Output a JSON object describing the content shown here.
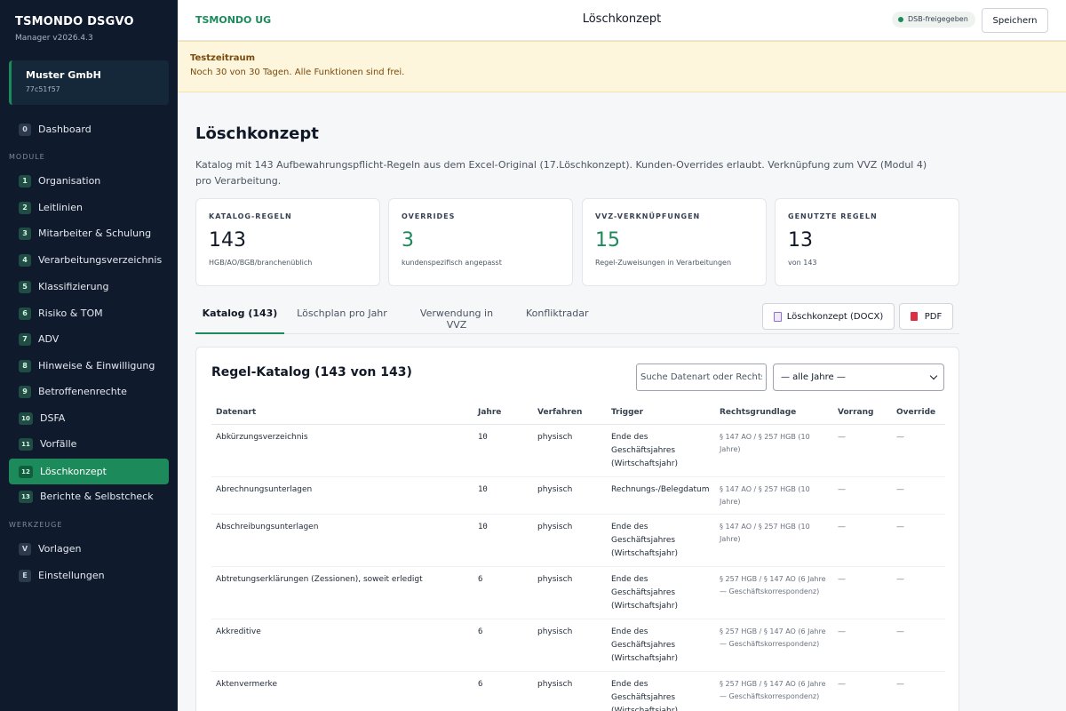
{
  "sidebar": {
    "brand_title": "TSMONDO DSGVO",
    "brand_version": "Manager v2026.4.3",
    "tenant_name": "Muster GmbH",
    "tenant_id": "77c51f57",
    "dashboard": {
      "badge": "0",
      "label": "Dashboard"
    },
    "section_module": "MODULE",
    "modules": [
      {
        "badge": "1",
        "label": "Organisation"
      },
      {
        "badge": "2",
        "label": "Leitlinien"
      },
      {
        "badge": "3",
        "label": "Mitarbeiter & Schulung"
      },
      {
        "badge": "4",
        "label": "Verarbeitungsverzeichnis"
      },
      {
        "badge": "5",
        "label": "Klassifizierung"
      },
      {
        "badge": "6",
        "label": "Risiko & TOM"
      },
      {
        "badge": "7",
        "label": "ADV"
      },
      {
        "badge": "8",
        "label": "Hinweise & Einwilligung"
      },
      {
        "badge": "9",
        "label": "Betroffenenrechte"
      },
      {
        "badge": "10",
        "label": "DSFA"
      },
      {
        "badge": "11",
        "label": "Vorfälle"
      },
      {
        "badge": "12",
        "label": "Löschkonzept"
      },
      {
        "badge": "13",
        "label": "Berichte & Selbstcheck"
      }
    ],
    "section_tools": "WERKZEUGE",
    "tools": [
      {
        "badge": "V",
        "label": "Vorlagen"
      },
      {
        "badge": "E",
        "label": "Einstellungen"
      }
    ]
  },
  "header": {
    "org_name": "TSMONDO UG",
    "title": "Löschkonzept",
    "status": "DSB-freigegeben",
    "save_label": "Speichern"
  },
  "trial": {
    "title": "Testzeitraum",
    "text": "Noch 30 von 30 Tagen. Alle Funktionen sind frei."
  },
  "main": {
    "title": "Löschkonzept",
    "description": "Katalog mit 143 Aufbewahrungspflicht-Regeln aus dem Excel-Original (17.Löschkonzept). Kunden-Overrides erlaubt. Verknüpfung zum VVZ (Modul 4) pro Verarbeitung."
  },
  "stats": [
    {
      "label": "KATALOG-REGELN",
      "value": "143",
      "sub": "HGB/AO/BGB/branchenüblich"
    },
    {
      "label": "OVERRIDES",
      "value": "3",
      "sub": "kundenspezifisch angepasst"
    },
    {
      "label": "VVZ-VERKNÜPFUNGEN",
      "value": "15",
      "sub": "Regel-Zuweisungen in Verarbeitungen"
    },
    {
      "label": "GENUTZTE REGELN",
      "value": "13",
      "sub": "von 143"
    }
  ],
  "tabs": [
    "Katalog (143)",
    "Löschplan pro Jahr",
    "Verwendung in VVZ",
    "Konfliktradar"
  ],
  "actions": {
    "docx": "Löschkonzept (DOCX)",
    "pdf": "PDF"
  },
  "catalog": {
    "title": "Regel-Katalog (143 von 143)",
    "search_placeholder": "Suche Datenart oder Rechtsgrundlage",
    "year_filter": "— alle Jahre —",
    "columns": [
      "Datenart",
      "Jahre",
      "Verfahren",
      "Trigger",
      "Rechtsgrundlage",
      "Vorrang",
      "Override"
    ],
    "rows": [
      {
        "datenart": "Abkürzungsverzeichnis",
        "jahre": "10",
        "verfahren": "physisch",
        "trigger": "Ende des Geschäftsjahres (Wirtschaftsjahr)",
        "rechtsgrundlage": "§ 147 AO / § 257 HGB (10 Jahre)",
        "vorrang": "—",
        "override": "—"
      },
      {
        "datenart": "Abrechnungsunterlagen",
        "jahre": "10",
        "verfahren": "physisch",
        "trigger": "Rechnungs-/Belegdatum",
        "rechtsgrundlage": "§ 147 AO / § 257 HGB (10 Jahre)",
        "vorrang": "—",
        "override": "—"
      },
      {
        "datenart": "Abschreibungsunterlagen",
        "jahre": "10",
        "verfahren": "physisch",
        "trigger": "Ende des Geschäftsjahres (Wirtschaftsjahr)",
        "rechtsgrundlage": "§ 147 AO / § 257 HGB (10 Jahre)",
        "vorrang": "—",
        "override": "—"
      },
      {
        "datenart": "Abtretungserklärungen (Zessionen), soweit erledigt",
        "jahre": "6",
        "verfahren": "physisch",
        "trigger": "Ende des Geschäftsjahres (Wirtschaftsjahr)",
        "rechtsgrundlage": "§ 257 HGB / § 147 AO (6 Jahre — Geschäftskorrespondenz)",
        "vorrang": "—",
        "override": "—"
      },
      {
        "datenart": "Akkreditive",
        "jahre": "6",
        "verfahren": "physisch",
        "trigger": "Ende des Geschäftsjahres (Wirtschaftsjahr)",
        "rechtsgrundlage": "§ 257 HGB / § 147 AO (6 Jahre — Geschäftskorrespondenz)",
        "vorrang": "—",
        "override": "—"
      },
      {
        "datenart": "Aktenvermerke",
        "jahre": "6",
        "verfahren": "physisch",
        "trigger": "Ende des Geschäftsjahres (Wirtschaftsjahr)",
        "rechtsgrundlage": "§ 257 HGB / § 147 AO (6 Jahre — Geschäftskorrespondenz)",
        "vorrang": "—",
        "override": "—"
      }
    ]
  }
}
